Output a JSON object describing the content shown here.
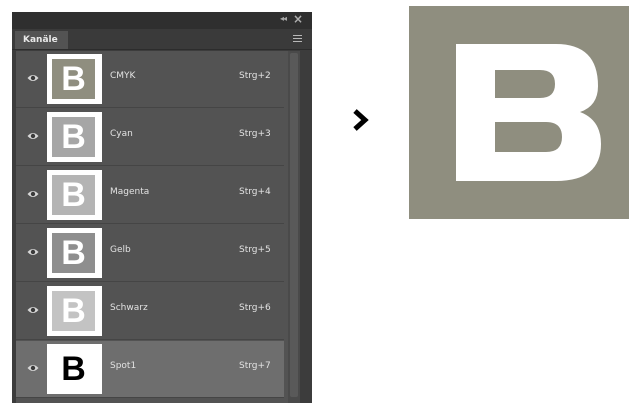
{
  "panel": {
    "tab_label": "Kanäle",
    "collapse_glyph": "◂◂",
    "close_glyph": "×",
    "channels": [
      {
        "name": "CMYK",
        "shortcut": "Strg+2",
        "thumb_bg": "#8f8e7f",
        "thumb_fg": "#ffffff",
        "selected": false
      },
      {
        "name": "Cyan",
        "shortcut": "Strg+3",
        "thumb_bg": "#a6a6a6",
        "thumb_fg": "#ffffff",
        "selected": false
      },
      {
        "name": "Magenta",
        "shortcut": "Strg+4",
        "thumb_bg": "#b4b4b4",
        "thumb_fg": "#ffffff",
        "selected": false
      },
      {
        "name": "Gelb",
        "shortcut": "Strg+5",
        "thumb_bg": "#8e8e8e",
        "thumb_fg": "#ffffff",
        "selected": false
      },
      {
        "name": "Schwarz",
        "shortcut": "Strg+6",
        "thumb_bg": "#c3c3c3",
        "thumb_fg": "#ffffff",
        "selected": false
      },
      {
        "name": "Spot1",
        "shortcut": "Strg+7",
        "thumb_bg": "#ffffff",
        "thumb_fg": "#000000",
        "selected": true
      }
    ],
    "thumb_glyph": "B"
  },
  "icons": {
    "eye": "eye-icon",
    "menu": "panel-menu-icon",
    "arrow": "chevron-right-icon",
    "collapse": "collapse-icon",
    "close": "close-icon"
  },
  "colors": {
    "panel_bg": "#535353",
    "selected_row": "#6e6e6e",
    "result_bg": "#8f8e7f",
    "result_letter": "#ffffff"
  }
}
